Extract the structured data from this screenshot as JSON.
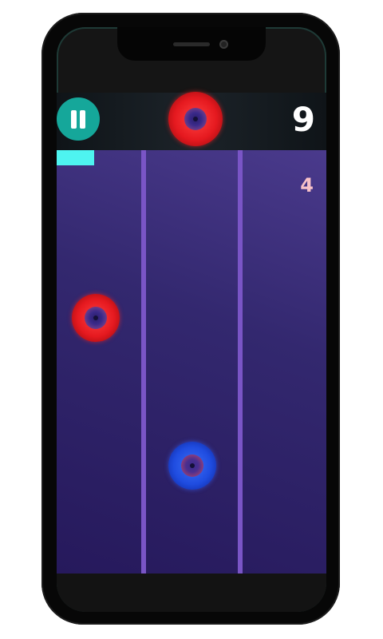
{
  "game": {
    "score": "9",
    "counter": "4",
    "timer_progress": 0.14
  },
  "hud": {
    "pause_icon": "pause-icon",
    "next_disc_color": "red"
  },
  "field": {
    "lanes": 3,
    "discs": [
      {
        "color": "red",
        "lane": 0
      },
      {
        "color": "blue",
        "lane": 1
      }
    ]
  },
  "colors": {
    "pause_button": "#15a79a",
    "progress": "#4ef4f0",
    "lane_divider": "#7a55c6",
    "counter": "#f8c2c8",
    "red_disc": "#e5191f",
    "blue_disc": "#1f4ce0"
  }
}
